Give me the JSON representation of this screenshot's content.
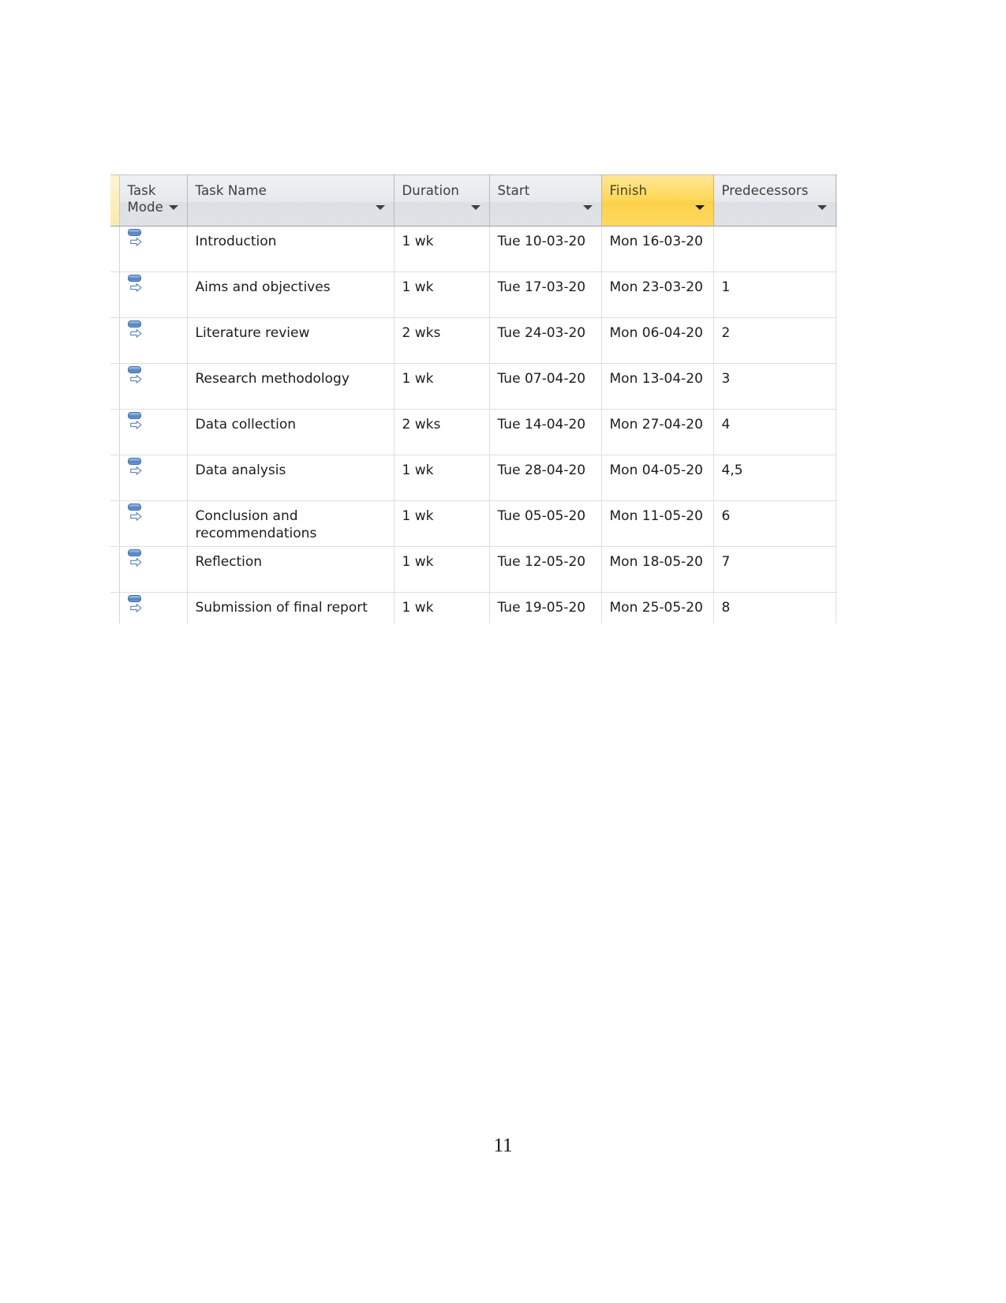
{
  "document": {
    "page_number": "11"
  },
  "project_table": {
    "app": "microsoft-project-entry-table",
    "highlighted_column": "Finish",
    "colors": {
      "header_background": "#e3e6ea",
      "header_highlight": "#ffd857",
      "header_text": "#3d3d3d",
      "grid_line": "#dcdee0",
      "row_stub": "#fbeaa8",
      "task_mode_icon": "#4d7cbb"
    },
    "columns": [
      {
        "key": "stub",
        "label": ""
      },
      {
        "key": "mode",
        "label": "Task\nMode"
      },
      {
        "key": "name",
        "label": "Task Name"
      },
      {
        "key": "dur",
        "label": "Duration"
      },
      {
        "key": "start",
        "label": "Start"
      },
      {
        "key": "finish",
        "label": "Finish"
      },
      {
        "key": "pred",
        "label": "Predecessors"
      }
    ],
    "rows": [
      {
        "mode": "auto-scheduled",
        "name": "Introduction",
        "duration": "1 wk",
        "start": "Tue 10-03-20",
        "finish": "Mon 16-03-20",
        "predecessors": ""
      },
      {
        "mode": "auto-scheduled",
        "name": "Aims and objectives",
        "duration": "1 wk",
        "start": "Tue 17-03-20",
        "finish": "Mon 23-03-20",
        "predecessors": "1"
      },
      {
        "mode": "auto-scheduled",
        "name": "Literature review",
        "duration": "2 wks",
        "start": "Tue 24-03-20",
        "finish": "Mon 06-04-20",
        "predecessors": "2"
      },
      {
        "mode": "auto-scheduled",
        "name": "Research methodology",
        "duration": "1 wk",
        "start": "Tue 07-04-20",
        "finish": "Mon 13-04-20",
        "predecessors": "3"
      },
      {
        "mode": "auto-scheduled",
        "name": "Data collection",
        "duration": "2 wks",
        "start": "Tue 14-04-20",
        "finish": "Mon 27-04-20",
        "predecessors": "4"
      },
      {
        "mode": "auto-scheduled",
        "name": "Data analysis",
        "duration": "1 wk",
        "start": "Tue 28-04-20",
        "finish": "Mon 04-05-20",
        "predecessors": "4,5"
      },
      {
        "mode": "auto-scheduled",
        "name": "Conclusion and\nrecommendations",
        "duration": "1 wk",
        "start": "Tue 05-05-20",
        "finish": "Mon 11-05-20",
        "predecessors": "6"
      },
      {
        "mode": "auto-scheduled",
        "name": "Reflection",
        "duration": "1 wk",
        "start": "Tue 12-05-20",
        "finish": "Mon 18-05-20",
        "predecessors": "7"
      },
      {
        "mode": "auto-scheduled",
        "name": "Submission of final report",
        "duration": "1 wk",
        "start": "Tue 19-05-20",
        "finish": "Mon 25-05-20",
        "predecessors": "8"
      }
    ]
  }
}
